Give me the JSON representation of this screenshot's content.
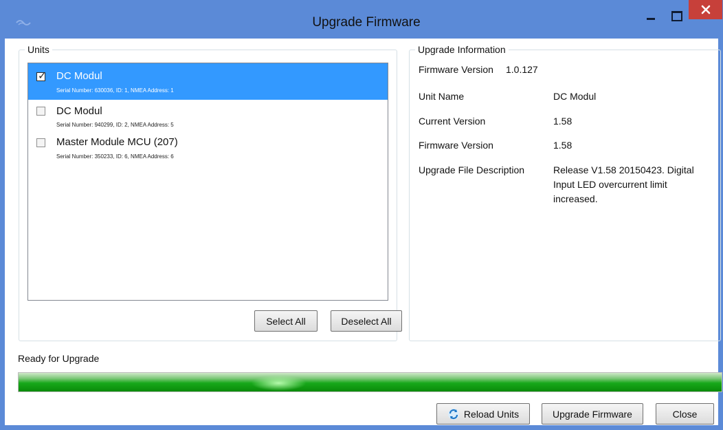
{
  "window": {
    "title": "Upgrade Firmware",
    "colors": {
      "frame": "#5b8ad7",
      "close": "#c7403a",
      "selection": "#3399ff",
      "progress": "#18a81a"
    }
  },
  "units": {
    "legend": "Units",
    "items": [
      {
        "name": "DC Modul",
        "detail": "Serial Number: 630036, ID: 1, NMEA Address: 1",
        "checked": true,
        "selected": true
      },
      {
        "name": "DC Modul",
        "detail": "Serial Number: 940299, ID: 2, NMEA Address: 5",
        "checked": false,
        "selected": false
      },
      {
        "name": "Master Module MCU (207)",
        "detail": "Serial Number: 350233, ID: 6, NMEA Address: 6",
        "checked": false,
        "selected": false
      }
    ],
    "select_all_label": "Select All",
    "deselect_all_label": "Deselect All"
  },
  "info": {
    "legend": "Upgrade Information",
    "firmware_version_label": "Firmware Version",
    "firmware_version_value": "1.0.127",
    "rows": [
      {
        "label": "Unit Name",
        "value": "DC Modul"
      },
      {
        "label": "Current Version",
        "value": "1.58"
      },
      {
        "label": "Firmware Version",
        "value": "1.58"
      },
      {
        "label": "Upgrade File Description",
        "value": "Release V1.58 20150423. Digital Input LED overcurrent limit increased."
      }
    ]
  },
  "status": {
    "text": "Ready for Upgrade",
    "progress_fraction": 1.0
  },
  "footer": {
    "reload_label": "Reload Units",
    "upgrade_label": "Upgrade Firmware",
    "close_label": "Close"
  }
}
